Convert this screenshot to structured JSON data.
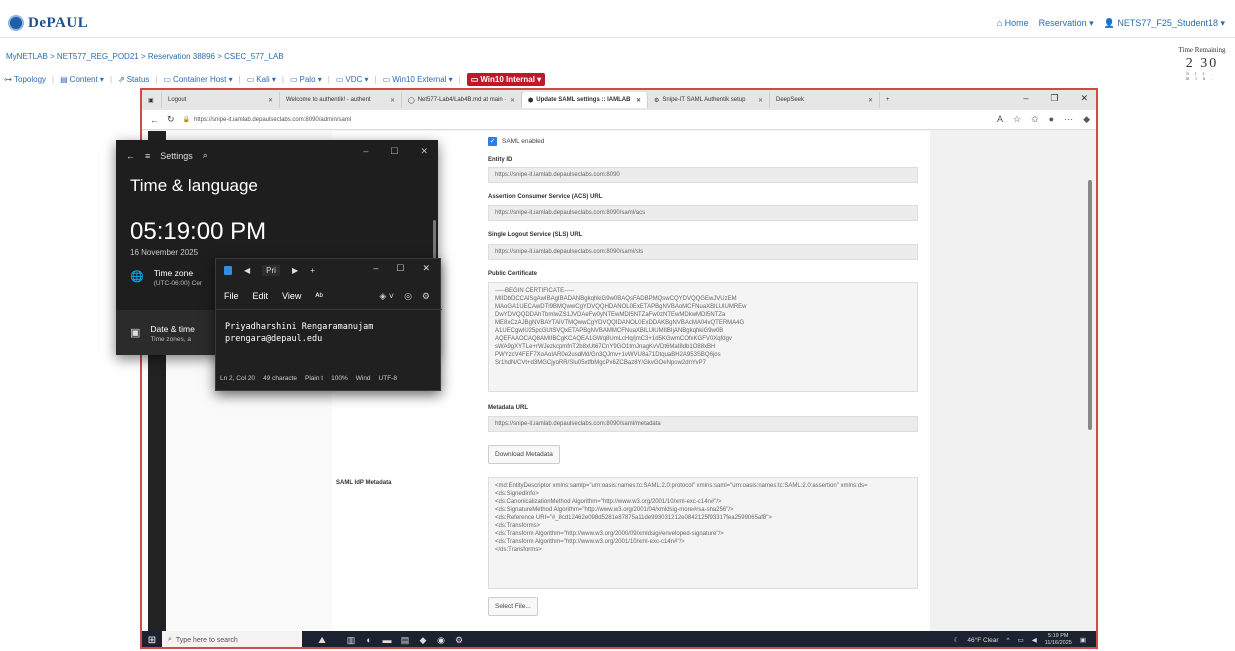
{
  "portal": {
    "logo_text": "DePAUL",
    "user_menu": {
      "home": "Home",
      "reservation": "Reservation ▾",
      "user": "NETS77_F25_Student18 ▾"
    },
    "breadcrumb": "MyNETLAB  >  NET577_REG_POD21  >  Reservation 38896  >  CSEC_577_LAB",
    "toolbar": [
      {
        "label": "Topology"
      },
      {
        "label": "Content ▾"
      },
      {
        "label": "Status"
      },
      {
        "label": "Container Host ▾"
      },
      {
        "label": "Kali ▾"
      },
      {
        "label": "Palo ▾"
      },
      {
        "label": "VDC ▾"
      },
      {
        "label": "Win10 External ▾"
      },
      {
        "label": "Win10 Internal ▾"
      }
    ],
    "time_remaining": {
      "title": "Time Remaining",
      "hours": "2",
      "minutes": "30",
      "units": "hrs. min."
    }
  },
  "browser": {
    "tabs": [
      {
        "label": "Logout"
      },
      {
        "label": "Welcome to authentik! - authent"
      },
      {
        "label": "Net577-Lab4/Lab4B.md at main ·"
      },
      {
        "label": "Update SAML settings :: IAMLAB"
      },
      {
        "label": "Snipe-IT SAML Authentik setup"
      },
      {
        "label": "DeepSeek"
      }
    ],
    "new_tab": "+",
    "url": "https://snipe-it.iamlab.depaulseclabs.com:8090/admin/saml"
  },
  "saml_form": {
    "saml_enabled_label": "SAML enabled",
    "entity_id_label": "Entity ID",
    "entity_id_value": "https://snipe-it.iamlab.depaulseclabs.com:8090",
    "acs_label": "Assertion Consumer Service (ACS) URL",
    "acs_value": "https://snipe-it.iamlab.depaulseclabs.com:8090/saml/acs",
    "sls_label": "Single Logout Service (SLS) URL",
    "sls_value": "https://snipe-it.iamlab.depaulseclabs.com:8090/saml/sls",
    "cert_label": "Public Certificate",
    "cert_lines": [
      "-----BEGIN CERTIFICATE-----",
      "MIIDbDCCAlSgAwIBAgIBADANBgkqhkiG9w0BAQsFADBPMQswCQYDVQQGEwJVUzEM",
      "MAoGA1UECAwDTl9BMQwwCgYDVQQHDANOL0ExETAPBgNVBAoMCFNuaXBlLUlUMREw",
      "DwYDVQQDDAhTbmlwZS1JVDAeFw0yNTEwMDI5NTZaFw0zNTEwMDkwMDI5NTZa",
      "ME8xCzAJBgNVBAYTAlVTMQwwCgYDVQQIDANOL0ExDDAKBgNVBAcMA04vQTERMA4G",
      "A1UECgwIU25pcGUtSVQxETAPBgNVBAMMCFNuaXBlLUlUMIIBIjANBgkqhkiG9w0B",
      "AQEFAAOCAQ8AMIIBCgKCAQEA1GWq8UmLcHq/jmC3+1d5KGwmCOfxKGFV0Xqfdgv",
      "sWA9gXYTLe+rWJezkcpmfnT2b8xUt67CnY9GO1tmJnagKvVDt6MaI8db1O88xBH",
      "PWYzcV4FEF7XoAoIAR0e2usdMd/Gn3QJmv+1vWVU8a71DtquaBH2A953SBQ6jos",
      "Sr1hdN/CVt+d3MGCjyoRR/Slu05xtfbMgcPx6ZCBaz8Y/GkvGOeNpow2dnYvP7"
    ],
    "metadata_url_label": "Metadata URL",
    "metadata_url_value": "https://snipe-it.iamlab.depaulseclabs.com:8090/saml/metadata",
    "download_button": "Download Metadata",
    "idp_label": "SAML IdP Metadata",
    "idp_lines": [
      "<md:EntityDescriptor xmlns:samlp=\"urn:oasis:names:tc:SAML:2.0:protocol\" xmlns:saml=\"urn:oasis:names:tc:SAML:2.0:assertion\" xmlns:ds=",
      "<ds:SignedInfo>",
      "<ds:CanonicalizationMethod Algorithm=\"http://www.w3.org/2001/10/xml-exc-c14n#\"/>",
      "<ds:SignatureMethod Algorithm=\"http://www.w3.org/2001/04/xmldsig-more#rsa-sha256\"/>",
      "<ds:Reference URI=\"#_8cd12462e098d5281e87875a11de993031212e0842125f93317fea2599065af8\">",
      "<ds:Transforms>",
      "<ds:Transform Algorithm=\"http://www.w3.org/2000/09/xmldsig#enveloped-signature\"/>",
      "<ds:Transform Algorithm=\"http://www.w3.org/2001/10/xml-exc-c14n#\"/>",
      "</ds:Transforms>"
    ],
    "select_file_button": "Select File..."
  },
  "settings_window": {
    "header": "Settings",
    "title": "Time & language",
    "clock": "05:19:00 PM",
    "date": "16 November 2025",
    "timezone_title": "Time zone",
    "timezone_value": "(UTC-06:00) Cer",
    "datetime_title": "Date & time",
    "datetime_sub": "Time zones, a"
  },
  "notepad": {
    "tab_label": "Pri",
    "menu": {
      "file": "File",
      "edit": "Edit",
      "view": "View"
    },
    "content_line1": "Priyadharshini Rengaramanujam",
    "content_line2": "prengara@depaul.edu",
    "status": {
      "position": "Ln 2, Col 20",
      "chars": "49 characte",
      "format": "Plain t",
      "zoom": "100%",
      "eol": "Wind",
      "encoding": "UTF-8"
    }
  },
  "taskbar": {
    "search_placeholder": "Type here to search",
    "weather": "46°F  Clear",
    "time": "5:19 PM",
    "date": "11/16/2025"
  },
  "colors": {
    "accent": "#1f4f8f",
    "active_tab": "#c0182a",
    "frame_border": "#d04a4a",
    "check": "#2d7be5"
  }
}
